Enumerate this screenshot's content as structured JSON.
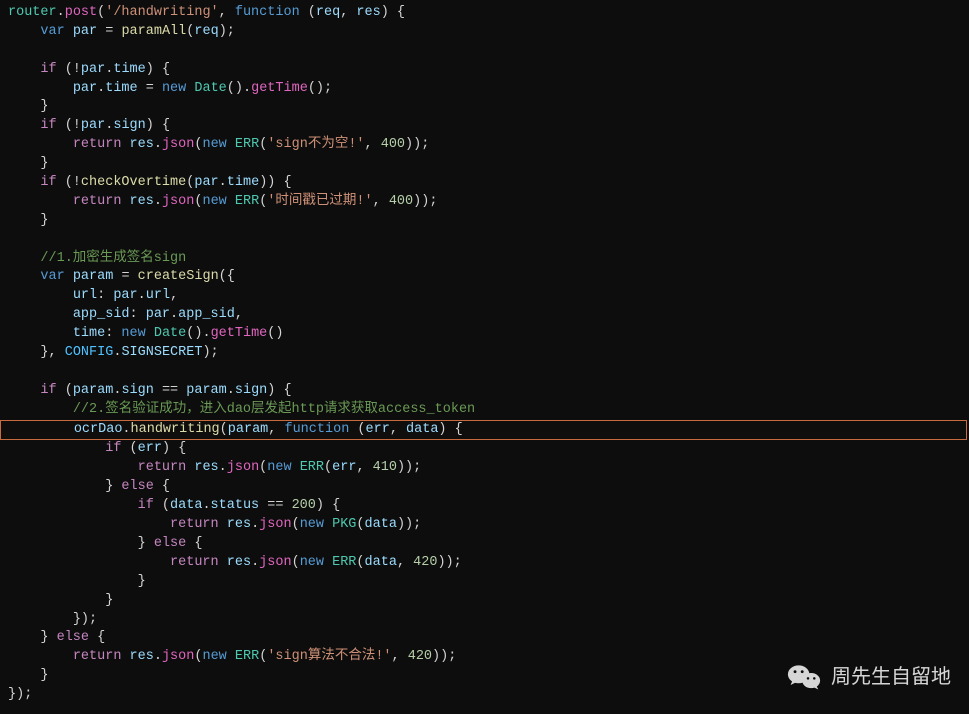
{
  "watermark": {
    "text": "周先生自留地"
  },
  "code": {
    "lines": [
      {
        "tokens": [
          [
            "kw1",
            "router"
          ],
          [
            "punc",
            "."
          ],
          [
            "fn2",
            "post"
          ],
          [
            "punc",
            "("
          ],
          [
            "str",
            "'/handwriting'"
          ],
          [
            "punc",
            ", "
          ],
          [
            "kw2",
            "function"
          ],
          [
            "punc",
            " ("
          ],
          [
            "param",
            "req"
          ],
          [
            "punc",
            ", "
          ],
          [
            "param",
            "res"
          ],
          [
            "punc",
            ") {"
          ]
        ]
      },
      {
        "indent": 1,
        "tokens": [
          [
            "kw2",
            "var"
          ],
          [
            "punc",
            " "
          ],
          [
            "prop",
            "par"
          ],
          [
            "punc",
            " = "
          ],
          [
            "fn",
            "paramAll"
          ],
          [
            "punc",
            "("
          ],
          [
            "prop",
            "req"
          ],
          [
            "punc",
            ");"
          ]
        ]
      },
      {
        "indent": 0,
        "tokens": [
          [
            "",
            ""
          ]
        ]
      },
      {
        "indent": 1,
        "tokens": [
          [
            "kw3",
            "if"
          ],
          [
            "punc",
            " (!"
          ],
          [
            "prop",
            "par"
          ],
          [
            "punc",
            "."
          ],
          [
            "prop",
            "time"
          ],
          [
            "punc",
            ") {"
          ]
        ]
      },
      {
        "indent": 2,
        "tokens": [
          [
            "prop",
            "par"
          ],
          [
            "punc",
            "."
          ],
          [
            "prop",
            "time"
          ],
          [
            "punc",
            " = "
          ],
          [
            "kw2",
            "new"
          ],
          [
            "punc",
            " "
          ],
          [
            "cls",
            "Date"
          ],
          [
            "punc",
            "()."
          ],
          [
            "fn2",
            "getTime"
          ],
          [
            "punc",
            "();"
          ]
        ]
      },
      {
        "indent": 1,
        "tokens": [
          [
            "punc",
            "}"
          ]
        ]
      },
      {
        "indent": 1,
        "tokens": [
          [
            "kw3",
            "if"
          ],
          [
            "punc",
            " (!"
          ],
          [
            "prop",
            "par"
          ],
          [
            "punc",
            "."
          ],
          [
            "prop",
            "sign"
          ],
          [
            "punc",
            ") {"
          ]
        ]
      },
      {
        "indent": 2,
        "tokens": [
          [
            "kw3",
            "return"
          ],
          [
            "punc",
            " "
          ],
          [
            "prop",
            "res"
          ],
          [
            "punc",
            "."
          ],
          [
            "fn2",
            "json"
          ],
          [
            "punc",
            "("
          ],
          [
            "kw2",
            "new"
          ],
          [
            "punc",
            " "
          ],
          [
            "cls",
            "ERR"
          ],
          [
            "punc",
            "("
          ],
          [
            "str",
            "'sign不为空!'"
          ],
          [
            "punc",
            ", "
          ],
          [
            "num",
            "400"
          ],
          [
            "punc",
            "));"
          ]
        ]
      },
      {
        "indent": 1,
        "tokens": [
          [
            "punc",
            "}"
          ]
        ]
      },
      {
        "indent": 1,
        "tokens": [
          [
            "kw3",
            "if"
          ],
          [
            "punc",
            " (!"
          ],
          [
            "fn",
            "checkOvertime"
          ],
          [
            "punc",
            "("
          ],
          [
            "prop",
            "par"
          ],
          [
            "punc",
            "."
          ],
          [
            "prop",
            "time"
          ],
          [
            "punc",
            ")) {"
          ]
        ]
      },
      {
        "indent": 2,
        "tokens": [
          [
            "kw3",
            "return"
          ],
          [
            "punc",
            " "
          ],
          [
            "prop",
            "res"
          ],
          [
            "punc",
            "."
          ],
          [
            "fn2",
            "json"
          ],
          [
            "punc",
            "("
          ],
          [
            "kw2",
            "new"
          ],
          [
            "punc",
            " "
          ],
          [
            "cls",
            "ERR"
          ],
          [
            "punc",
            "("
          ],
          [
            "str",
            "'时间戳已过期!'"
          ],
          [
            "punc",
            ", "
          ],
          [
            "num",
            "400"
          ],
          [
            "punc",
            "));"
          ]
        ]
      },
      {
        "indent": 1,
        "tokens": [
          [
            "punc",
            "}"
          ]
        ]
      },
      {
        "indent": 0,
        "tokens": [
          [
            "",
            ""
          ]
        ]
      },
      {
        "indent": 1,
        "tokens": [
          [
            "cmt",
            "//1.加密生成签名sign"
          ]
        ]
      },
      {
        "indent": 1,
        "tokens": [
          [
            "kw2",
            "var"
          ],
          [
            "punc",
            " "
          ],
          [
            "prop",
            "param"
          ],
          [
            "punc",
            " = "
          ],
          [
            "fn",
            "createSign"
          ],
          [
            "punc",
            "({"
          ]
        ]
      },
      {
        "indent": 2,
        "tokens": [
          [
            "prop",
            "url"
          ],
          [
            "punc",
            ": "
          ],
          [
            "prop",
            "par"
          ],
          [
            "punc",
            "."
          ],
          [
            "prop",
            "url"
          ],
          [
            "punc",
            ","
          ]
        ]
      },
      {
        "indent": 2,
        "tokens": [
          [
            "prop",
            "app_sid"
          ],
          [
            "punc",
            ": "
          ],
          [
            "prop",
            "par"
          ],
          [
            "punc",
            "."
          ],
          [
            "prop",
            "app_sid"
          ],
          [
            "punc",
            ","
          ]
        ]
      },
      {
        "indent": 2,
        "tokens": [
          [
            "prop",
            "time"
          ],
          [
            "punc",
            ": "
          ],
          [
            "kw2",
            "new"
          ],
          [
            "punc",
            " "
          ],
          [
            "cls",
            "Date"
          ],
          [
            "punc",
            "()."
          ],
          [
            "fn2",
            "getTime"
          ],
          [
            "punc",
            "()"
          ]
        ]
      },
      {
        "indent": 1,
        "tokens": [
          [
            "punc",
            "}, "
          ],
          [
            "cons",
            "CONFIG"
          ],
          [
            "punc",
            "."
          ],
          [
            "prop",
            "SIGNSECRET"
          ],
          [
            "punc",
            ");"
          ]
        ]
      },
      {
        "indent": 0,
        "tokens": [
          [
            "",
            ""
          ]
        ]
      },
      {
        "indent": 1,
        "tokens": [
          [
            "kw3",
            "if"
          ],
          [
            "punc",
            " ("
          ],
          [
            "prop",
            "param"
          ],
          [
            "punc",
            "."
          ],
          [
            "prop",
            "sign"
          ],
          [
            "punc",
            " == "
          ],
          [
            "prop",
            "param"
          ],
          [
            "punc",
            "."
          ],
          [
            "prop",
            "sign"
          ],
          [
            "punc",
            ") {"
          ]
        ]
      },
      {
        "indent": 2,
        "tokens": [
          [
            "cmt",
            "//2.签名验证成功，进入dao层发起http请求获取access_token"
          ]
        ]
      },
      {
        "hl": true,
        "indent": 2,
        "tokens": [
          [
            "prop",
            "ocrDao"
          ],
          [
            "punc",
            "."
          ],
          [
            "fn",
            "handwriting"
          ],
          [
            "punc",
            "("
          ],
          [
            "prop",
            "param"
          ],
          [
            "punc",
            ", "
          ],
          [
            "kw2",
            "function"
          ],
          [
            "punc",
            " ("
          ],
          [
            "param",
            "err"
          ],
          [
            "punc",
            ", "
          ],
          [
            "param",
            "data"
          ],
          [
            "punc",
            ") {"
          ]
        ]
      },
      {
        "indent": 3,
        "tokens": [
          [
            "kw3",
            "if"
          ],
          [
            "punc",
            " ("
          ],
          [
            "prop",
            "err"
          ],
          [
            "punc",
            ") {"
          ]
        ]
      },
      {
        "indent": 4,
        "tokens": [
          [
            "kw3",
            "return"
          ],
          [
            "punc",
            " "
          ],
          [
            "prop",
            "res"
          ],
          [
            "punc",
            "."
          ],
          [
            "fn2",
            "json"
          ],
          [
            "punc",
            "("
          ],
          [
            "kw2",
            "new"
          ],
          [
            "punc",
            " "
          ],
          [
            "cls",
            "ERR"
          ],
          [
            "punc",
            "("
          ],
          [
            "prop",
            "err"
          ],
          [
            "punc",
            ", "
          ],
          [
            "num",
            "410"
          ],
          [
            "punc",
            "));"
          ]
        ]
      },
      {
        "indent": 3,
        "tokens": [
          [
            "punc",
            "} "
          ],
          [
            "kw3",
            "else"
          ],
          [
            "punc",
            " {"
          ]
        ]
      },
      {
        "indent": 4,
        "tokens": [
          [
            "kw3",
            "if"
          ],
          [
            "punc",
            " ("
          ],
          [
            "prop",
            "data"
          ],
          [
            "punc",
            "."
          ],
          [
            "prop",
            "status"
          ],
          [
            "punc",
            " == "
          ],
          [
            "num",
            "200"
          ],
          [
            "punc",
            ") {"
          ]
        ]
      },
      {
        "indent": 5,
        "tokens": [
          [
            "kw3",
            "return"
          ],
          [
            "punc",
            " "
          ],
          [
            "prop",
            "res"
          ],
          [
            "punc",
            "."
          ],
          [
            "fn2",
            "json"
          ],
          [
            "punc",
            "("
          ],
          [
            "kw2",
            "new"
          ],
          [
            "punc",
            " "
          ],
          [
            "cls",
            "PKG"
          ],
          [
            "punc",
            "("
          ],
          [
            "prop",
            "data"
          ],
          [
            "punc",
            "));"
          ]
        ]
      },
      {
        "indent": 4,
        "tokens": [
          [
            "punc",
            "} "
          ],
          [
            "kw3",
            "else"
          ],
          [
            "punc",
            " {"
          ]
        ]
      },
      {
        "indent": 5,
        "tokens": [
          [
            "kw3",
            "return"
          ],
          [
            "punc",
            " "
          ],
          [
            "prop",
            "res"
          ],
          [
            "punc",
            "."
          ],
          [
            "fn2",
            "json"
          ],
          [
            "punc",
            "("
          ],
          [
            "kw2",
            "new"
          ],
          [
            "punc",
            " "
          ],
          [
            "cls",
            "ERR"
          ],
          [
            "punc",
            "("
          ],
          [
            "prop",
            "data"
          ],
          [
            "punc",
            ", "
          ],
          [
            "num",
            "420"
          ],
          [
            "punc",
            "));"
          ]
        ]
      },
      {
        "indent": 4,
        "tokens": [
          [
            "punc",
            "}"
          ]
        ]
      },
      {
        "indent": 3,
        "tokens": [
          [
            "punc",
            "}"
          ]
        ]
      },
      {
        "indent": 2,
        "tokens": [
          [
            "punc",
            "});"
          ]
        ]
      },
      {
        "indent": 1,
        "tokens": [
          [
            "punc",
            "} "
          ],
          [
            "kw3",
            "else"
          ],
          [
            "punc",
            " {"
          ]
        ]
      },
      {
        "indent": 2,
        "tokens": [
          [
            "kw3",
            "return"
          ],
          [
            "punc",
            " "
          ],
          [
            "prop",
            "res"
          ],
          [
            "punc",
            "."
          ],
          [
            "fn2",
            "json"
          ],
          [
            "punc",
            "("
          ],
          [
            "kw2",
            "new"
          ],
          [
            "punc",
            " "
          ],
          [
            "cls",
            "ERR"
          ],
          [
            "punc",
            "("
          ],
          [
            "str",
            "'sign算法不合法!'"
          ],
          [
            "punc",
            ", "
          ],
          [
            "num",
            "420"
          ],
          [
            "punc",
            "));"
          ]
        ]
      },
      {
        "indent": 1,
        "tokens": [
          [
            "punc",
            "}"
          ]
        ]
      },
      {
        "indent": 0,
        "tokens": [
          [
            "punc",
            "});"
          ]
        ]
      }
    ]
  }
}
